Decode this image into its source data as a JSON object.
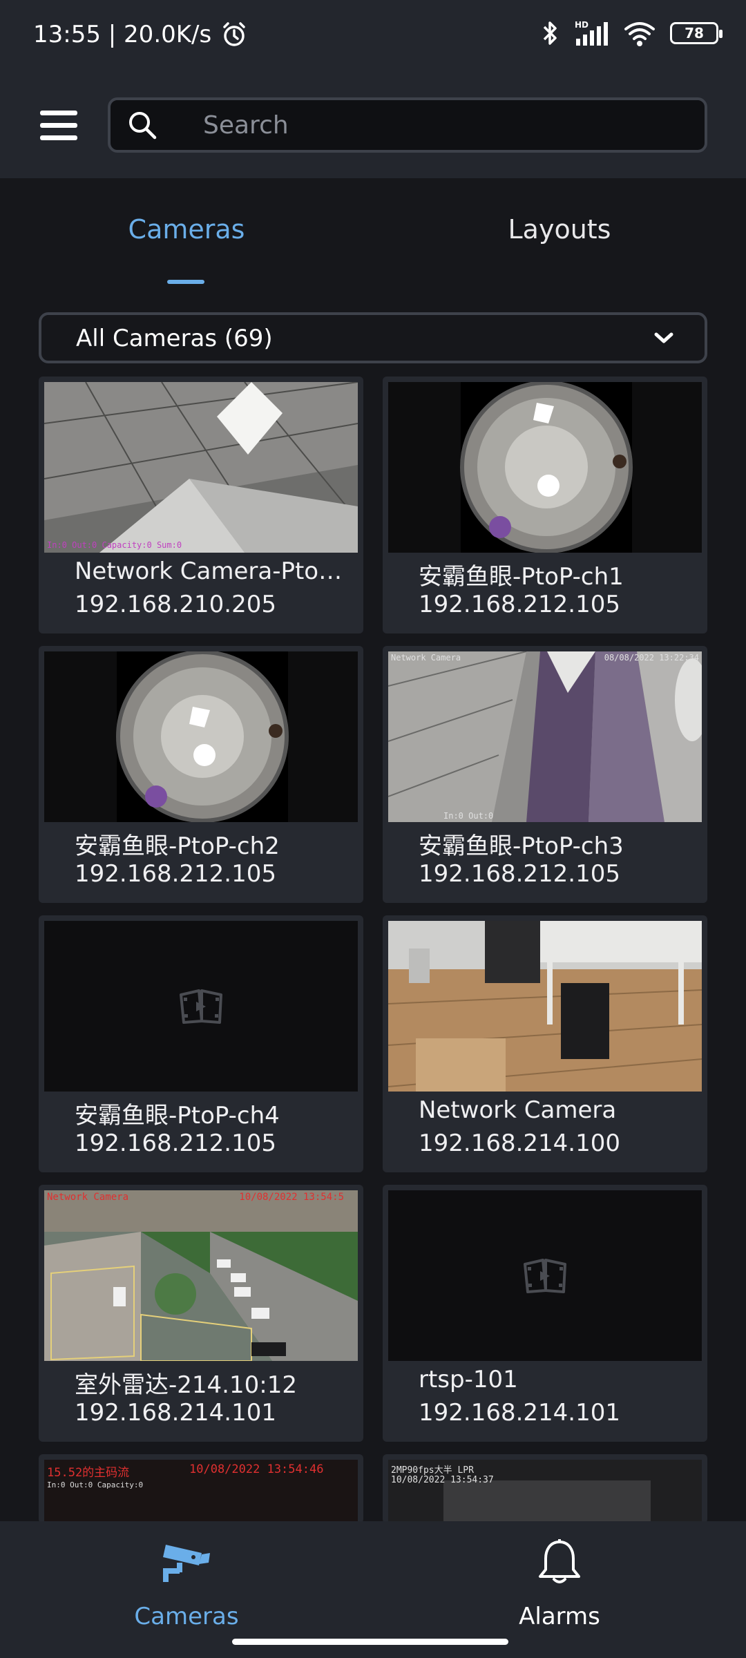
{
  "status_bar": {
    "time_speed": "13:55 | 20.0K/s",
    "battery": "78"
  },
  "header": {
    "search_placeholder": "Search"
  },
  "tabs": [
    {
      "label": "Cameras",
      "active": true
    },
    {
      "label": "Layouts",
      "active": false
    }
  ],
  "filter": {
    "label": "All Cameras (69)"
  },
  "cameras": [
    {
      "name": "Network Camera-PtoP-...",
      "ip": "192.168.210.205",
      "thumb": "ceiling"
    },
    {
      "name": "安霸鱼眼-PtoP-ch1",
      "ip": "192.168.212.105",
      "thumb": "fisheye"
    },
    {
      "name": "安霸鱼眼-PtoP-ch2",
      "ip": "192.168.212.105",
      "thumb": "fisheye"
    },
    {
      "name": "安霸鱼眼-PtoP-ch3",
      "ip": "192.168.212.105",
      "thumb": "ceiling-purple"
    },
    {
      "name": "安霸鱼眼-PtoP-ch4",
      "ip": "192.168.212.105",
      "thumb": "placeholder"
    },
    {
      "name": "Network Camera",
      "ip": "192.168.214.100",
      "thumb": "office"
    },
    {
      "name": "室外雷达-214.10:12",
      "ip": "192.168.214.101",
      "thumb": "outdoor"
    },
    {
      "name": "rtsp-101",
      "ip": "192.168.214.101",
      "thumb": "placeholder"
    }
  ],
  "thumb_overlays": {
    "cam1": "In:0  Out:0  Capacity:0  Sum:0",
    "cam4_left": "Network Camera",
    "cam4_right": "08/08/2022 13:22:34",
    "cam4_bottom": "In:0 Out:0",
    "cam7_left": "Network Camera",
    "cam7_right": "10/08/2022 13:54:5",
    "partial1_title": "15.52的主码流",
    "partial1_time": "10/08/2022 13:54:46",
    "partial1_stats": "In:0  Out:0  Capacity:0",
    "partial2_title": "2MP90fps大半 LPR",
    "partial2_time": "10/08/2022 13:54:37"
  },
  "bottom_nav": [
    {
      "label": "Cameras",
      "icon": "cctv-camera-icon",
      "active": true
    },
    {
      "label": "Alarms",
      "icon": "bell-icon",
      "active": false
    }
  ],
  "colors": {
    "accent": "#6aaee9",
    "background": "#16171b",
    "surface": "#23262d",
    "card": "#262930"
  }
}
